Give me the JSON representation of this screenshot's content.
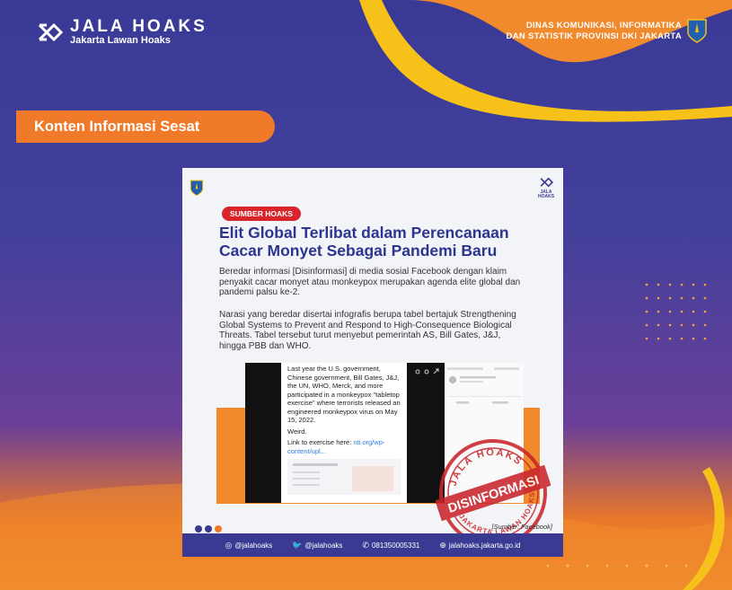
{
  "brand": {
    "name": "JALA HOAKS",
    "tagline": "Jakarta Lawan Hoaks"
  },
  "agency": {
    "line1": "DINAS KOMUNIKASI, INFORMATIKA",
    "line2": "DAN STATISTIK PROVINSI DKI JAKARTA"
  },
  "category_label": "Konten Informasi Sesat",
  "card": {
    "logo_text": "JALA HOAKS",
    "badge": "SUMBER HOAKS",
    "title_line1": "Elit Global Terlibat dalam Perencanaan",
    "title_line2": "Cacar Monyet Sebagai Pandemi Baru",
    "para1": "Beredar informasi [Disinformasi] di media sosial Facebook dengan klaim penyakit cacar monyet atau monkeypox merupakan agenda elite global dan pandemi palsu ke-2.",
    "para2": "Narasi yang beredar disertai infografis berupa tabel bertajuk Strengthening Global Systems to Prevent and Respond to High-Consequence Biological Threats. Tabel tersebut turut menyebut pemerintah AS, Bill Gates, J&J, hingga PBB dan WHO.",
    "tweet_text": "Last year the U.S. government, Chinese government, Bill Gates, J&J, the UN, WHO, Merck, and more participated in a monkeypox \"tabletop exercise\" where terrorists released an engineered monkeypox virus on May 15, 2022.",
    "tweet_weird": "Weird.",
    "tweet_link_prefix": "Link to exercise here: ",
    "tweet_link": "nti.org/wp-content/upl...",
    "stamp_top": "JALA HOAKS",
    "stamp_main": "DISINFORMASI",
    "stamp_bottom": "JAKARTA LAWAN HOAKS",
    "source": "[Sumber: Facebook]",
    "footer": {
      "instagram": "@jalahoaks",
      "twitter": "@jalahoaks",
      "whatsapp": "081350005331",
      "website": "jalahoaks.jakarta.go.id"
    }
  },
  "colors": {
    "navy": "#3b3a92",
    "orange": "#f07a2a",
    "red": "#d8252c",
    "yellow": "#f6c21a"
  }
}
